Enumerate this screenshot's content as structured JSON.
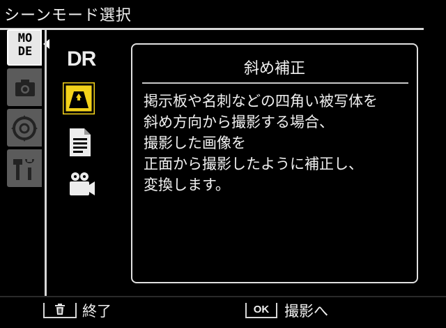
{
  "header": {
    "title": "シーンモード選択"
  },
  "sidebar": {
    "tabs": [
      {
        "icon": "mode-icon",
        "label": "MO\nDE",
        "active": true
      },
      {
        "icon": "camera-icon",
        "active": false
      },
      {
        "icon": "setup-dial-icon",
        "active": false
      },
      {
        "icon": "wrench-icon",
        "active": false
      }
    ]
  },
  "scenes": [
    {
      "icon": "dr-icon",
      "label": "DR"
    },
    {
      "icon": "skew-correction-icon",
      "selected": true
    },
    {
      "icon": "text-document-icon"
    },
    {
      "icon": "movie-camera-icon"
    }
  ],
  "description": {
    "title": "斜め補正",
    "body": "掲示板や名刺などの四角い被写体を\n斜め方向から撮影する場合、\n撮影した画像を\n正面から撮影したように補正し、\n変換します。"
  },
  "footer": {
    "end_key_icon": "trash-icon",
    "end_label": "終了",
    "ok_key": "OK",
    "ok_label": "撮影へ"
  },
  "colors": {
    "background": "#000000",
    "selected_icon": "#f3d21a",
    "inactive_tab": "#5b5b5b",
    "text": "#f0f0f0"
  }
}
